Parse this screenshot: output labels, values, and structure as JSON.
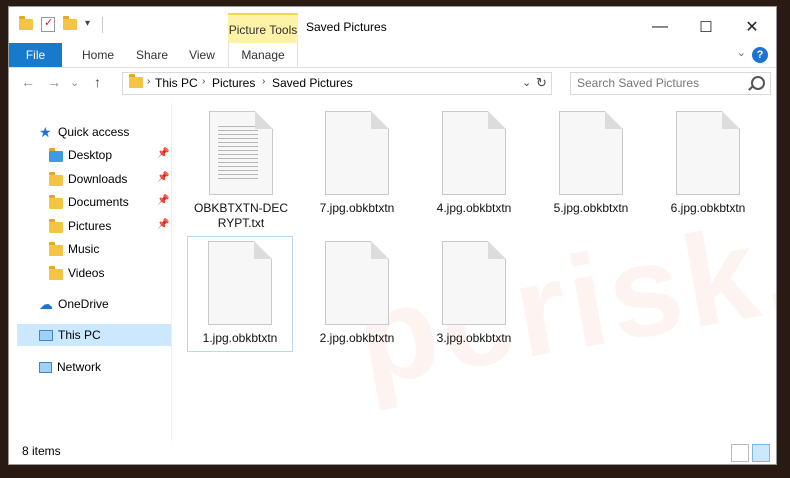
{
  "window": {
    "title": "Saved Pictures"
  },
  "ribbon": {
    "context_tab": "Picture Tools",
    "tabs": [
      "File",
      "Home",
      "Share",
      "View",
      "Manage"
    ],
    "help": "?"
  },
  "quick_access_toolbar": {
    "dropdown": "▾"
  },
  "window_controls": {
    "minimize": "—",
    "maximize": "☐",
    "close": "✕"
  },
  "nav": {
    "back": "←",
    "forward": "→",
    "recent": "⌄",
    "up": "↑"
  },
  "address": {
    "crumbs": [
      "This PC",
      "Pictures",
      "Saved Pictures"
    ],
    "separator": "›"
  },
  "search": {
    "placeholder": "Search Saved Pictures"
  },
  "navpane": {
    "items": [
      {
        "label": "Quick access",
        "icon": "star-icon"
      },
      {
        "label": "Desktop",
        "icon": "desktop-folder-icon",
        "pinned": true
      },
      {
        "label": "Downloads",
        "icon": "downloads-folder-icon",
        "pinned": true
      },
      {
        "label": "Documents",
        "icon": "documents-folder-icon",
        "pinned": true
      },
      {
        "label": "Pictures",
        "icon": "pictures-folder-icon",
        "pinned": true
      },
      {
        "label": "Music",
        "icon": "music-folder-icon"
      },
      {
        "label": "Videos",
        "icon": "videos-folder-icon"
      },
      {
        "label": "OneDrive",
        "icon": "cloud-icon"
      },
      {
        "label": "This PC",
        "icon": "computer-icon",
        "selected": true
      },
      {
        "label": "Network",
        "icon": "network-icon"
      }
    ]
  },
  "files": [
    {
      "name": "OBKBTXTN-DECRYPT.txt",
      "type": "text"
    },
    {
      "name": "7.jpg.obkbtxtn",
      "type": "blank"
    },
    {
      "name": "4.jpg.obkbtxtn",
      "type": "blank"
    },
    {
      "name": "5.jpg.obkbtxtn",
      "type": "blank"
    },
    {
      "name": "6.jpg.obkbtxtn",
      "type": "blank"
    },
    {
      "name": "1.jpg.obkbtxtn",
      "type": "blank",
      "selected": true
    },
    {
      "name": "2.jpg.obkbtxtn",
      "type": "blank"
    },
    {
      "name": "3.jpg.obkbtxtn",
      "type": "blank"
    }
  ],
  "status": {
    "items": "8 items"
  },
  "watermark": "pcrisk.com",
  "colors": {
    "accent": "#1979ca",
    "context_tab": "#fdf2a6",
    "selection": "#cce8ff"
  }
}
